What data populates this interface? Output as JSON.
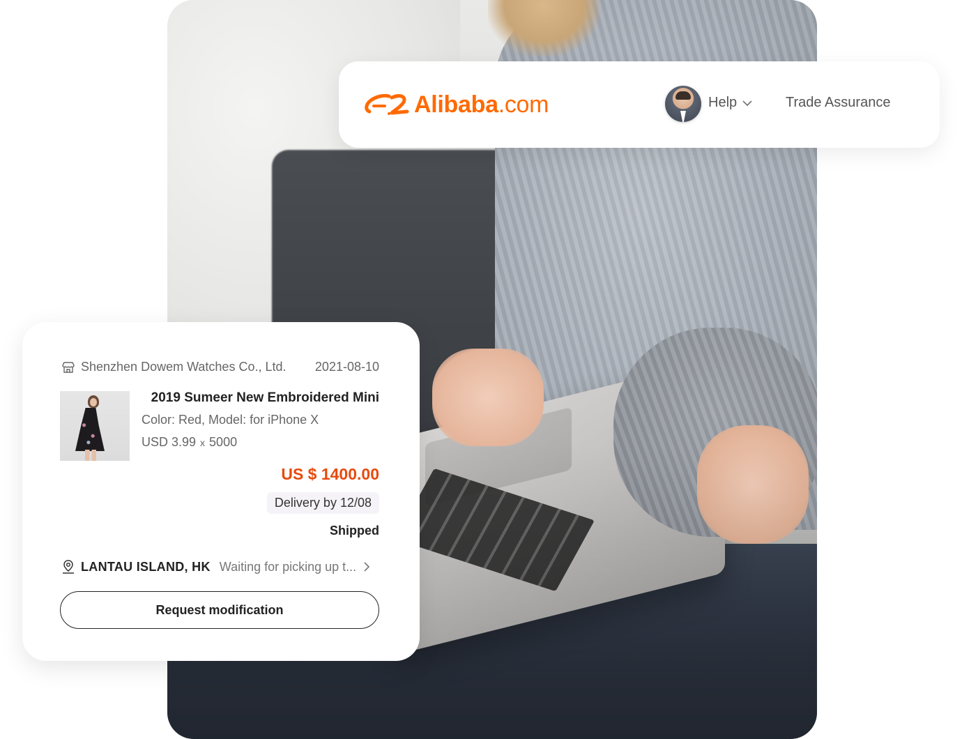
{
  "header": {
    "logo_text_bold": "Alibaba",
    "logo_text_light": ".com",
    "help_label": "Help",
    "trade_assurance_label": "Trade Assurance",
    "brand_color": "#ff6a00"
  },
  "order": {
    "store_name": "Shenzhen Dowem Watches Co., Ltd.",
    "date": "2021-08-10",
    "product_title": "2019 Sumeer New Embroidered Mini",
    "attributes": "Color: Red, Model: for iPhone X",
    "unit_price": "USD 3.99",
    "multiplier": "x",
    "quantity": "5000",
    "total": "US $ 1400.00",
    "total_color": "#e84a0c",
    "delivery": "Delivery by 12/08",
    "status": "Shipped",
    "location": "LANTAU ISLAND, HK",
    "location_status": "Waiting for picking up t...",
    "action_button": "Request modification"
  },
  "icons": {
    "store": "store-icon",
    "location": "location-pin-icon",
    "chevron_down": "chevron-down-icon",
    "chevron_right": "chevron-right-icon"
  }
}
